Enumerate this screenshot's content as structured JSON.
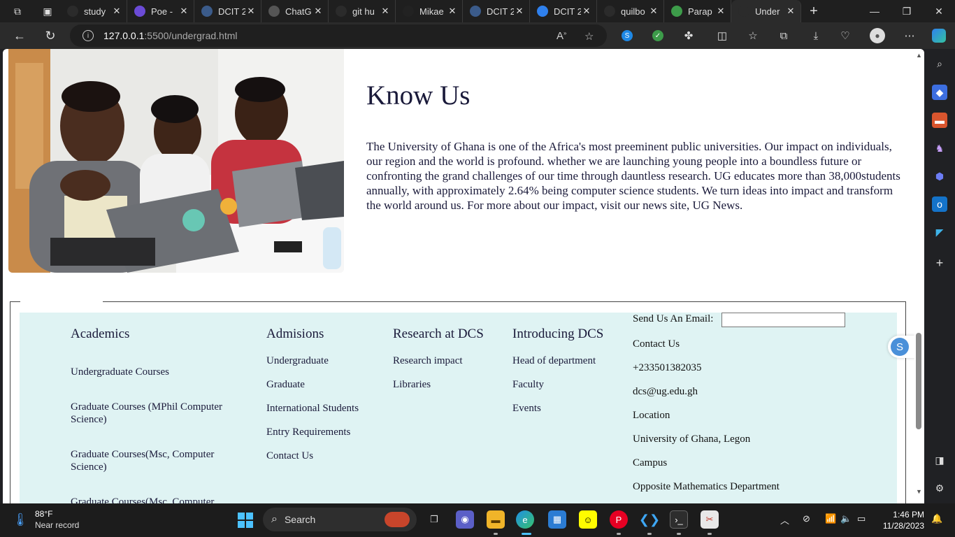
{
  "browser": {
    "tabs": [
      {
        "label": "study",
        "icon": "search-icon",
        "color": "#2b2b2b"
      },
      {
        "label": "Poe -",
        "icon": "poe-icon",
        "color": "#6b4bd6"
      },
      {
        "label": "DCIT 2",
        "icon": "s-icon",
        "color": "#3b5b8a"
      },
      {
        "label": "ChatG",
        "icon": "chatgpt-icon",
        "color": "#555"
      },
      {
        "label": "git hu",
        "icon": "search-icon",
        "color": "#2b2b2b"
      },
      {
        "label": "Mikae",
        "icon": "github-icon",
        "color": "#222"
      },
      {
        "label": "DCIT 2",
        "icon": "s-icon",
        "color": "#3b5b8a"
      },
      {
        "label": "DCIT 2",
        "icon": "s-icon",
        "color": "#2f80ed"
      },
      {
        "label": "quilbo",
        "icon": "search-icon",
        "color": "#2b2b2b"
      },
      {
        "label": "Parap",
        "icon": "quillbot-icon",
        "color": "#3d9c4a"
      },
      {
        "label": "Under",
        "icon": "page-icon",
        "color": "#2b2b2b"
      }
    ],
    "url_host": "127.0.0.1",
    "url_path": ":5500/undergrad.html"
  },
  "page": {
    "know_title": "Know Us",
    "know_body": "The University of Ghana is one of the Africa's most preeminent public universities. Our impact on individuals, our region and the world is profound. whether we are launching young people into a boundless future or confronting the grand challenges of our time through dauntless research. UG educates more than 38,000students annually, with approximately 2.64% being computer science students. We turn ideas into impact and transform the world around us. For more about our impact, visit our news site, UG News."
  },
  "footer": {
    "academics": {
      "heading": "Academics",
      "links": [
        "Undergraduate Courses",
        "Graduate Courses (MPhil Computer",
        "Science)",
        "Graduate Courses(Msc, Computer",
        "Science)",
        "Graduate Courses(Msc, Computer"
      ]
    },
    "admissions": {
      "heading": "Admisions",
      "links": [
        "Undergraduate",
        "Graduate",
        "International Students",
        "Entry Requirements",
        "Contact Us"
      ]
    },
    "research": {
      "heading": "Research at DCS",
      "links": [
        "Research impact",
        "Libraries"
      ]
    },
    "introducing": {
      "heading": "Introducing DCS",
      "links": [
        "Head of department",
        "Faculty",
        "Events"
      ]
    },
    "contact": {
      "email_label": "Send Us An Email:",
      "email_value": "",
      "lines": [
        "Contact Us",
        "+233501382035",
        "dcs@ug.edu.gh",
        "Location",
        "University of Ghana, Legon",
        "Campus",
        "Opposite Mathematics Department"
      ]
    }
  },
  "taskbar": {
    "temp": "88°F",
    "weather": "Near record",
    "search_label": "Search",
    "time": "1:46 PM",
    "date": "11/28/2023"
  }
}
